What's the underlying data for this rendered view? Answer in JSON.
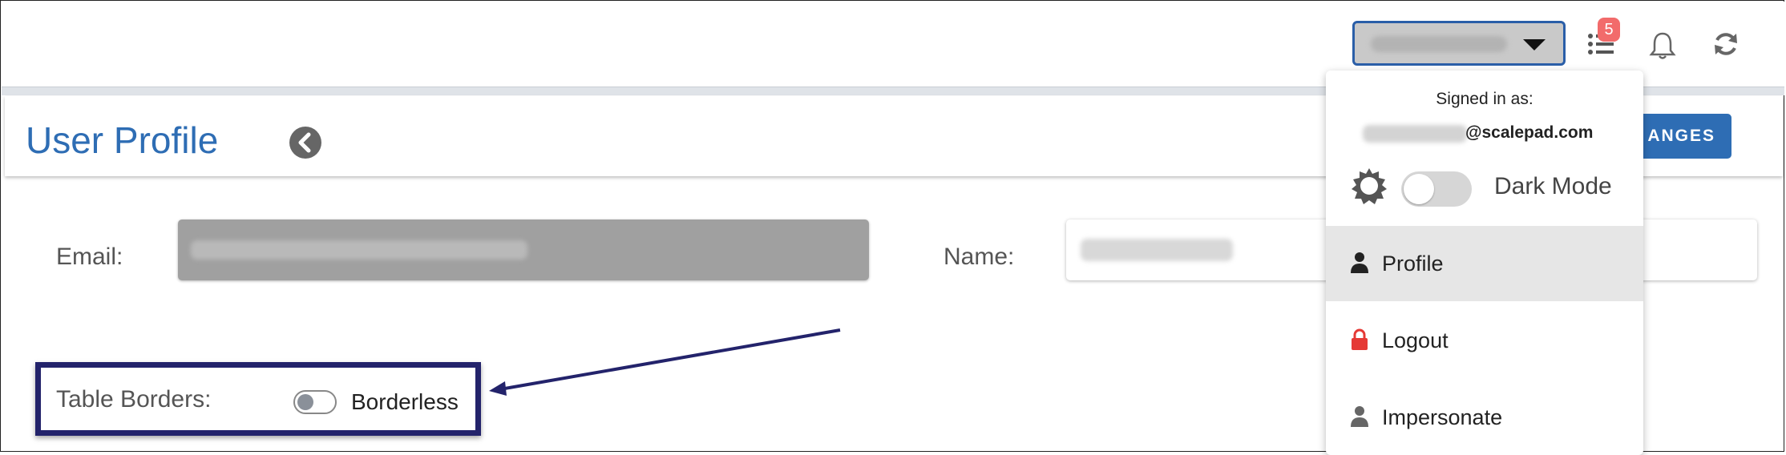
{
  "topbar": {
    "notifications_count": "5",
    "icons": [
      "caret-down-icon",
      "list-icon",
      "bell-icon",
      "refresh-icon"
    ]
  },
  "header": {
    "title": "User Profile",
    "save_button_label": "SAVE CHANGES",
    "save_button_visible_text": "ANGES"
  },
  "form": {
    "email_label": "Email:",
    "name_label": "Name:",
    "table_borders_label": "Table Borders:",
    "borders_toggle_label": "Borderless",
    "borders_toggle_on": false
  },
  "user_menu": {
    "signed_in_label": "Signed in as:",
    "email_domain": "@scalepad.com",
    "dark_mode_label": "Dark Mode",
    "dark_mode_on": false,
    "items": [
      {
        "label": "Profile",
        "icon": "user-icon",
        "active": true
      },
      {
        "label": "Logout",
        "icon": "lock-icon",
        "active": false
      },
      {
        "label": "Impersonate",
        "icon": "user-icon",
        "active": false
      }
    ]
  },
  "colors": {
    "accent": "#2e6db4",
    "highlight_box": "#23236b",
    "badge": "#f26b6b",
    "logout_icon": "#e53935"
  }
}
